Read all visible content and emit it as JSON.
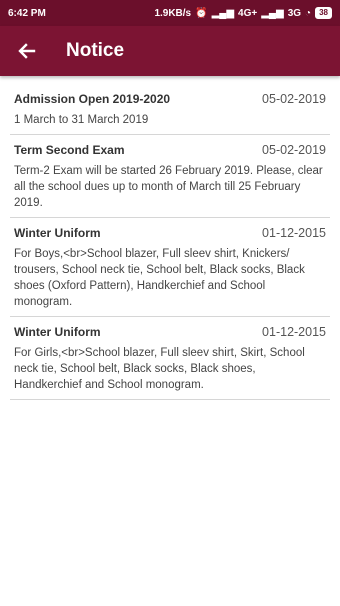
{
  "statusbar": {
    "time": "6:42 PM",
    "speed": "1.9KB/s",
    "network1": "4G+",
    "network2": "3G",
    "battery": "38"
  },
  "appbar": {
    "back_icon": "arrow-left-icon",
    "title": "Notice"
  },
  "notices": [
    {
      "title": "Admission Open 2019-2020",
      "date": "05-02-2019",
      "body": "1 March to 31 March 2019"
    },
    {
      "title": "Term Second Exam",
      "date": "05-02-2019",
      "body": "Term-2 Exam will be started 26 February 2019. Please, clear all the school dues up to month of March till 25 February 2019."
    },
    {
      "title": "Winter Uniform",
      "date": "01-12-2015",
      "body": "For Boys,<br>School blazer, Full sleev shirt, Knickers/ trousers, School neck tie, School belt, Black socks, Black shoes (Oxford Pattern), Handkerchief and School monogram."
    },
    {
      "title": "Winter Uniform",
      "date": "01-12-2015",
      "body": "For Girls,<br>School blazer, Full sleev shirt, Skirt, School neck tie, School belt, Black socks, Black shoes, Handkerchief and School monogram."
    }
  ],
  "colors": {
    "appbar": "#7c1433",
    "statusbar": "#6b0f2b"
  }
}
